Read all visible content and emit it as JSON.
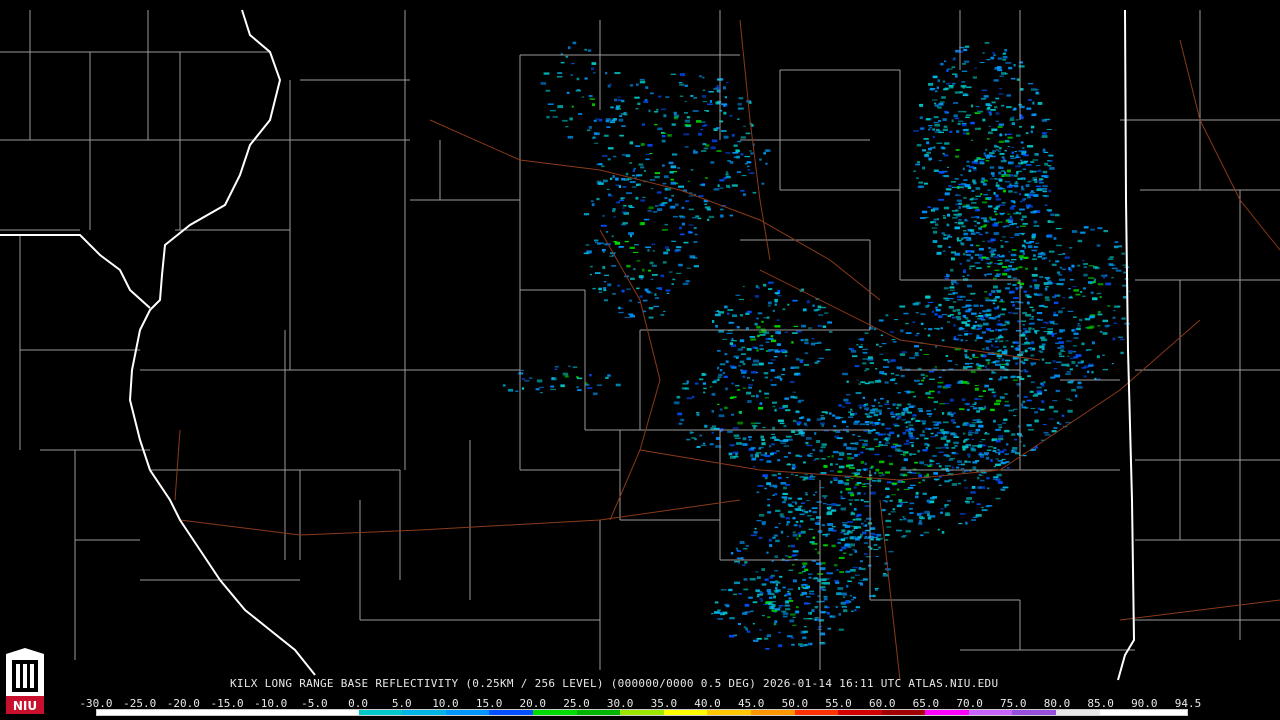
{
  "product": {
    "title": "KILX LONG RANGE BASE REFLECTIVITY (0.25KM / 256 LEVEL) (000000/0000 0.5 DEG) 2026-01-14 16:11 UTC  ATLAS.NIU.EDU"
  },
  "logo": {
    "text": "NIU",
    "color": "#c8102e"
  },
  "colorbar": {
    "labels": [
      "-30.0",
      "-25.0",
      "-20.0",
      "-15.0",
      "-10.0",
      "-5.0",
      "0.0",
      "5.0",
      "10.0",
      "15.0",
      "20.0",
      "25.0",
      "30.0",
      "35.0",
      "40.0",
      "45.0",
      "50.0",
      "55.0",
      "60.0",
      "65.0",
      "70.0",
      "75.0",
      "80.0",
      "85.0",
      "90.0",
      "94.5"
    ],
    "colors": [
      "#ffffff",
      "#ffffff",
      "#ffffff",
      "#ffffff",
      "#ffffff",
      "#ffffff",
      "#00c8c8",
      "#00b4e6",
      "#0096ff",
      "#0050ff",
      "#00dc00",
      "#00b400",
      "#9ce600",
      "#ffff00",
      "#ffc800",
      "#ff9600",
      "#ff3200",
      "#d20000",
      "#a00000",
      "#ff00ff",
      "#c864ff",
      "#9650dc",
      "#e6e6e6",
      "#ffffff",
      "#ffffff"
    ]
  },
  "map_colors": {
    "county_lines": "#9a9a9a",
    "state_lines": "#ffffff",
    "highways": "#8b3a1a",
    "background": "#000000"
  }
}
